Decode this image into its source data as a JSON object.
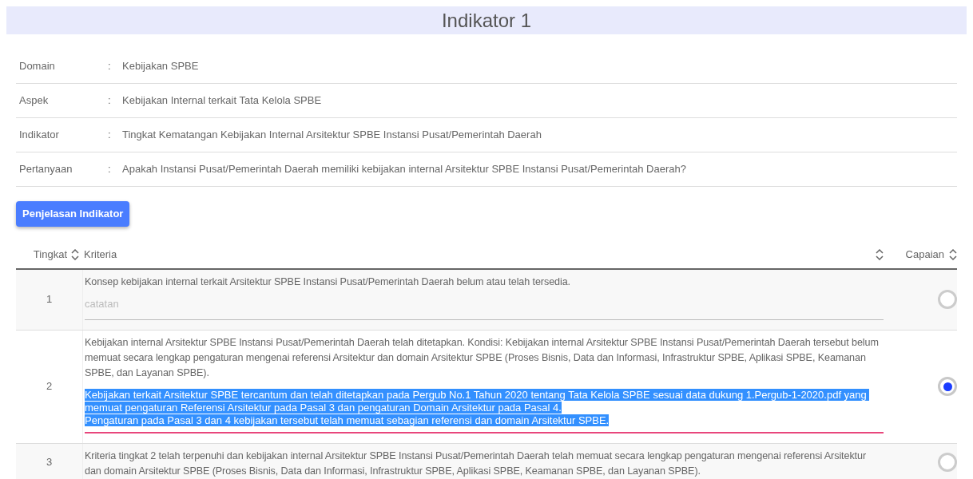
{
  "title": "Indikator 1",
  "info": [
    {
      "label": "Domain",
      "value": "Kebijakan SPBE"
    },
    {
      "label": "Aspek",
      "value": "Kebijakan Internal terkait Tata Kelola SPBE"
    },
    {
      "label": "Indikator",
      "value": "Tingkat Kematangan Kebijakan Internal Arsitektur SPBE Instansi Pusat/Pemerintah Daerah"
    },
    {
      "label": "Pertanyaan",
      "value": "Apakah Instansi Pusat/Pemerintah Daerah memiliki kebijakan internal Arsitektur SPBE Instansi Pusat/Pemerintah Daerah?"
    }
  ],
  "separator": ":",
  "button": "Penjelasan Indikator",
  "table": {
    "columns": [
      {
        "label": "Tingkat"
      },
      {
        "label": "Kriteria"
      },
      {
        "label": "Capaian"
      }
    ],
    "rows": [
      {
        "level": "1",
        "criteria": "Konsep kebijakan internal terkait Arsitektur SPBE Instansi Pusat/Pemerintah Daerah belum atau telah tersedia.",
        "note": {
          "placeholder": "catatan",
          "focused": false
        },
        "selected": false
      },
      {
        "level": "2",
        "criteria": "Kebijakan internal Arsitektur SPBE Instansi Pusat/Pemerintah Daerah telah ditetapkan. Kondisi: Kebijakan internal Arsitektur SPBE Instansi Pusat/Pemerintah Daerah tersebut belum memuat secara lengkap pengaturan mengenai referensi Arsitektur dan domain Arsitektur SPBE (Proses Bisnis, Data dan Informasi, Infrastruktur SPBE, Aplikasi SPBE, Keamanan SPBE, dan Layanan SPBE).",
        "note": {
          "value": "Kebijakan terkait Arsitektur SPBE tercantum dan telah ditetapkan pada Pergub No.1 Tahun 2020 tentang Tata Kelola SPBE sesuai data dukung 1.Pergub-1-2020.pdf yang memuat pengaturan Referensi Arsitektur pada Pasal 3 dan pengaturan Domain Arsitektur pada Pasal 4.\nPengaturan pada Pasal 3 dan 4 kebijakan tersebut telah memuat sebagian referensi dan domain Arsitektur SPBE.",
          "focused": true,
          "text_selected": true
        },
        "selected": true
      },
      {
        "level": "3",
        "criteria": "Kriteria tingkat 2 telah terpenuhi dan kebijakan internal Arsitektur SPBE Instansi Pusat/Pemerintah Daerah telah memuat secara lengkap pengaturan mengenai referensi Arsitektur dan domain Arsitektur SPBE (Proses Bisnis, Data dan Informasi, Infrastruktur SPBE, Aplikasi SPBE, Keamanan SPBE, dan Layanan SPBE).",
        "selected": false
      }
    ]
  }
}
